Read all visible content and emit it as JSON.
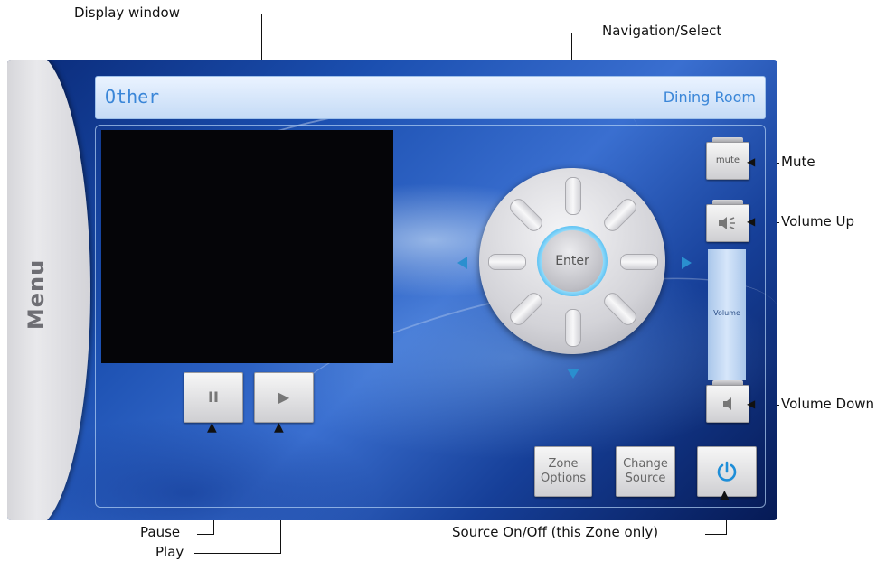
{
  "callouts": {
    "display_window": "Display window",
    "navigation_select": "Navigation/Select",
    "mute": "Mute",
    "volume_up": "Volume Up",
    "volume_down": "Volume Down",
    "pause": "Pause",
    "play": "Play",
    "source_on_off": "Source On/Off (this Zone only)"
  },
  "panel": {
    "menu_label": "Menu",
    "title_left": "Other",
    "title_right": "Dining Room",
    "pause_glyph": "II",
    "play_glyph": "▶",
    "enter_label": "Enter",
    "mute_label": "mute",
    "volume_label": "Volume",
    "zone_options_label": "Zone Options",
    "change_source_label": "Change Source",
    "power_glyph": "⏻"
  },
  "icons": {
    "speaker_up": "speaker-up-icon",
    "speaker_down": "speaker-down-icon",
    "power": "power-icon"
  },
  "colors": {
    "accent_blue": "#3a86d8",
    "nav_arrow": "#2a8fcf"
  }
}
